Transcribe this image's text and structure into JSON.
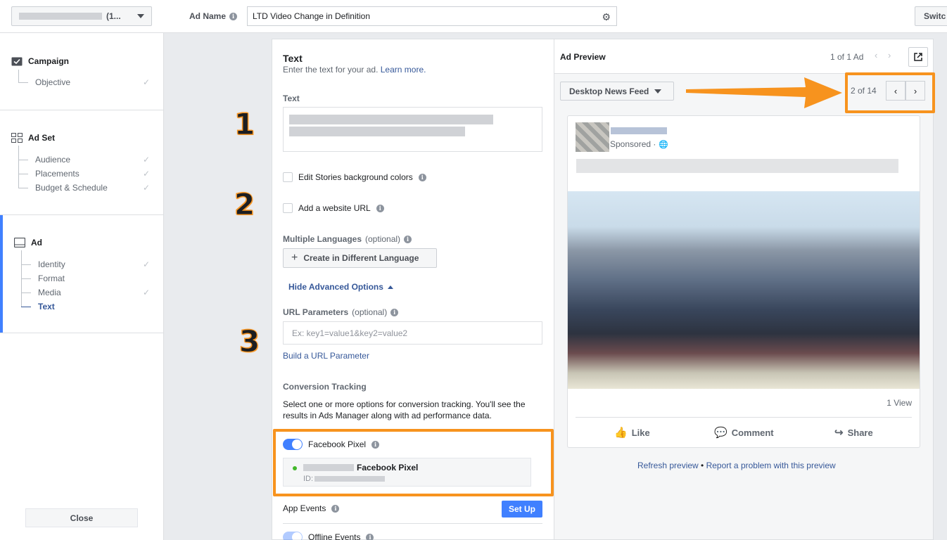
{
  "topbar": {
    "account_suffix": "(1...",
    "ad_name_label": "Ad Name",
    "ad_name_value": "LTD Video Change in Definition",
    "switch_label": "Switc"
  },
  "sidebar": {
    "campaign": {
      "title": "Campaign",
      "items": [
        {
          "label": "Objective",
          "done": true
        }
      ]
    },
    "adset": {
      "title": "Ad Set",
      "items": [
        {
          "label": "Audience",
          "done": true
        },
        {
          "label": "Placements",
          "done": true
        },
        {
          "label": "Budget & Schedule",
          "done": true
        }
      ]
    },
    "ad": {
      "title": "Ad",
      "items": [
        {
          "label": "Identity",
          "done": true
        },
        {
          "label": "Format",
          "done": false
        },
        {
          "label": "Media",
          "done": true
        },
        {
          "label": "Text",
          "done": false,
          "active": true
        }
      ]
    },
    "close_label": "Close"
  },
  "form": {
    "title": "Text",
    "subtitle": "Enter the text for your ad.",
    "learn_more": "Learn more.",
    "text_label": "Text",
    "stories_bg": "Edit Stories background colors",
    "website_url": "Add a website URL",
    "multi_lang_label": "Multiple Languages",
    "optional": "(optional)",
    "create_lang_button": "Create in Different Language",
    "hide_advanced": "Hide Advanced Options",
    "url_params_label": "URL Parameters",
    "url_params_placeholder": "Ex: key1=value1&key2=value2",
    "build_url": "Build a URL Parameter",
    "conversion_label": "Conversion Tracking",
    "conversion_desc": "Select one or more options for conversion tracking. You'll see the results in Ads Manager along with ad performance data.",
    "facebook_pixel_label": "Facebook Pixel",
    "pixel_name": "Facebook Pixel",
    "pixel_id_prefix": "ID:",
    "app_events_label": "App Events",
    "setup_button": "Set Up",
    "offline_events_label": "Offline Events"
  },
  "preview": {
    "title": "Ad Preview",
    "ad_count": "1 of 1 Ad",
    "placement": "Desktop News Feed",
    "placement_count": "2 of 14",
    "sponsored": "Sponsored ·",
    "views": "1 View",
    "like": "Like",
    "comment": "Comment",
    "share": "Share",
    "refresh": "Refresh preview",
    "bullet": " • ",
    "report": "Report a problem with this preview"
  },
  "annotations": {
    "one": "1",
    "two": "2",
    "three": "3"
  },
  "colors": {
    "accent": "#4080ff",
    "link": "#365899",
    "highlight": "#f7931e"
  }
}
